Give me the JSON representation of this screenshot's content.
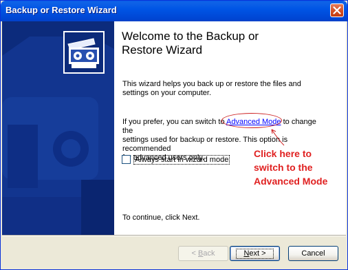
{
  "window": {
    "title": "Backup or Restore Wizard"
  },
  "main": {
    "heading_line1": "Welcome to the Backup or",
    "heading_line2": "Restore Wizard",
    "intro_line1": "This wizard helps you back up or restore the files and",
    "intro_line2": "settings on your computer.",
    "advanced_pre": "If you prefer, you can switch to ",
    "advanced_link": "Advanced Mode",
    "advanced_post": " to change the",
    "advanced_line2": "settings used for backup or restore. This option is recommended",
    "advanced_line3": "for advanced users only.",
    "checkbox_label": "Always start in wizard mode",
    "checkbox_checked": false,
    "continue_text": "To continue, click Next."
  },
  "annotation": {
    "line1": "Click here to",
    "line2": "switch to the",
    "line3": "Advanced Mode",
    "color": "#e02020"
  },
  "buttons": {
    "back_prefix": "< ",
    "back_accel": "B",
    "back_rest": "ack",
    "next_accel": "N",
    "next_rest": "ext >",
    "cancel": "Cancel",
    "back_enabled": false
  },
  "icons": {
    "close": "close-icon",
    "logo": "backup-wizard-icon"
  },
  "colors": {
    "titlebar": "#0055e5",
    "side_panel": "#0b2a7a",
    "dialog_face": "#ece9d8",
    "link": "#0000ff"
  }
}
